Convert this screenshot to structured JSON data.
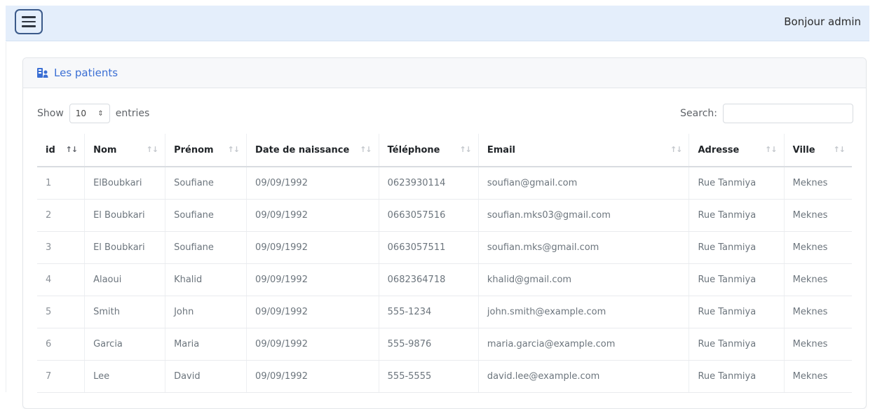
{
  "header": {
    "greeting": "Bonjour admin"
  },
  "card": {
    "title": "Les patients",
    "show_label": "Show",
    "entries_label": "entries",
    "page_length": "10",
    "search_label": "Search:",
    "search_value": ""
  },
  "table": {
    "columns": [
      "id",
      "Nom",
      "Prénom",
      "Date de naissance",
      "Téléphone",
      "Email",
      "Adresse",
      "Ville"
    ],
    "sorted_column": "id",
    "rows": [
      [
        "1",
        "ElBoubkari",
        "Soufiane",
        "09/09/1992",
        "0623930114",
        "soufian@gmail.com",
        "Rue Tanmiya",
        "Meknes"
      ],
      [
        "2",
        "El Boubkari",
        "Soufiane",
        "09/09/1992",
        "0663057516",
        "soufian.mks03@gmail.com",
        "Rue Tanmiya",
        "Meknes"
      ],
      [
        "3",
        "El Boubkari",
        "Soufiane",
        "09/09/1992",
        "0663057511",
        "soufian.mks@gmail.com",
        "Rue Tanmiya",
        "Meknes"
      ],
      [
        "4",
        "Alaoui",
        "Khalid",
        "09/09/1992",
        "0682364718",
        "khalid@gmail.com",
        "Rue Tanmiya",
        "Meknes"
      ],
      [
        "5",
        "Smith",
        "John",
        "09/09/1992",
        "555-1234",
        "john.smith@example.com",
        "Rue Tanmiya",
        "Meknes"
      ],
      [
        "6",
        "Garcia",
        "Maria",
        "09/09/1992",
        "555-9876",
        "maria.garcia@example.com",
        "Rue Tanmiya",
        "Meknes"
      ],
      [
        "7",
        "Lee",
        "David",
        "09/09/1992",
        "555-5555",
        "david.lee@example.com",
        "Rue Tanmiya",
        "Meknes"
      ]
    ]
  },
  "icons": {
    "menu": "hamburger-icon",
    "title": "hospital-user-icon",
    "sort": "sort-icon"
  },
  "colors": {
    "topbar": "#e4eefb",
    "accent": "#3b6fd4"
  }
}
